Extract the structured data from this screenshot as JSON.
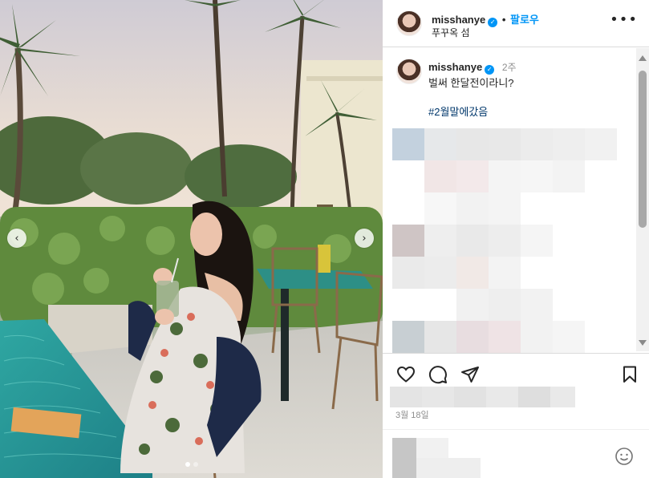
{
  "header": {
    "username": "misshanye",
    "separator": "•",
    "follow_label": "팔로우",
    "location": "푸꾸옥 섬",
    "more_icon": "more-horizontal-icon"
  },
  "caption": {
    "username": "misshanye",
    "time_ago": "2주",
    "text": "벌써 한달전이라니?",
    "hashtag": "#2월말에갔음"
  },
  "photo": {
    "prev_glyph": "‹",
    "next_glyph": "›",
    "slide_count": 2,
    "active_slide": 1
  },
  "actions": {
    "icons": [
      "heart-icon",
      "comment-icon",
      "share-icon",
      "bookmark-icon"
    ]
  },
  "post_date": "3월 18일",
  "comment_bar": {
    "emoji_icon": "emoji-icon"
  },
  "colors": {
    "accent": "#0095f6",
    "hashtag": "#00376b",
    "text": "#262626",
    "muted": "#8e8e8e"
  }
}
